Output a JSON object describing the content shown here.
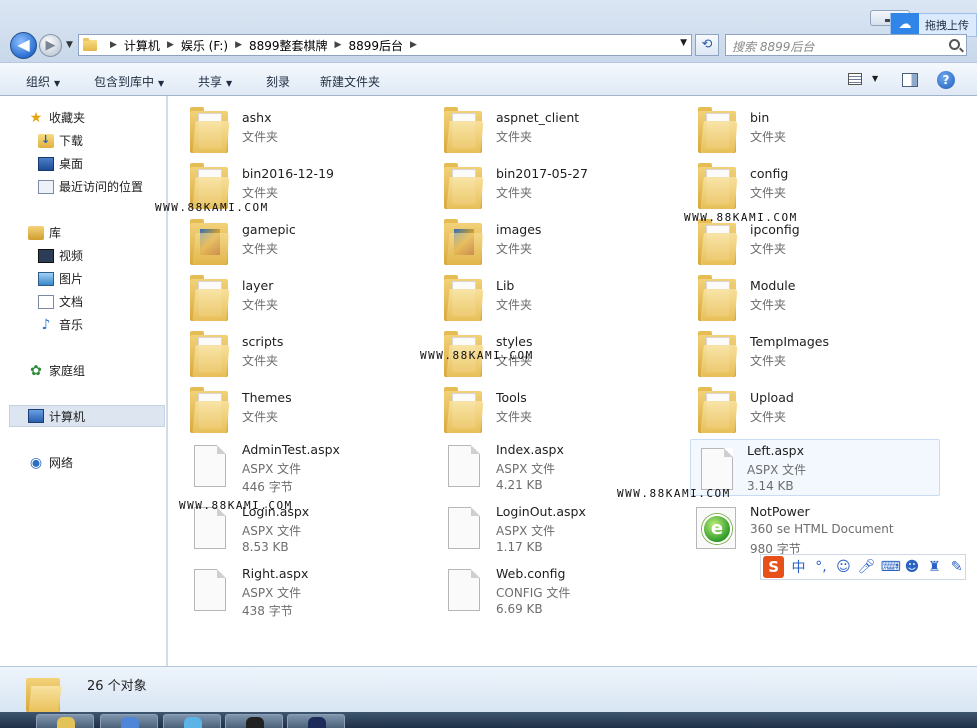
{
  "window": {
    "breadcrumb": [
      "计算机",
      "娱乐 (F:)",
      "8899整套棋牌",
      "8899后台"
    ],
    "search_placeholder": "搜索 8899后台",
    "cloud_label": "拖拽上传"
  },
  "toolbar": {
    "organize": "组织",
    "include_library": "包含到库中",
    "share": "共享",
    "burn": "刻录",
    "new_folder": "新建文件夹"
  },
  "sidebar": {
    "favorites": "收藏夹",
    "downloads": "下载",
    "desktop": "桌面",
    "recent": "最近访问的位置",
    "libraries": "库",
    "videos": "视频",
    "pictures": "图片",
    "documents": "文档",
    "music": "音乐",
    "homegroup": "家庭组",
    "computer": "计算机",
    "network": "网络"
  },
  "items": [
    {
      "name": "ashx",
      "type": "文件夹",
      "icon": "folder-icon"
    },
    {
      "name": "aspnet_client",
      "type": "文件夹",
      "icon": "folder-icon"
    },
    {
      "name": "bin",
      "type": "文件夹",
      "icon": "folder-icon"
    },
    {
      "name": "bin2016-12-19",
      "type": "文件夹",
      "icon": "folder-icon"
    },
    {
      "name": "bin2017-05-27",
      "type": "文件夹",
      "icon": "folder-icon"
    },
    {
      "name": "config",
      "type": "文件夹",
      "icon": "folder-icon"
    },
    {
      "name": "gamepic",
      "type": "文件夹",
      "icon": "picture-folder-icon"
    },
    {
      "name": "images",
      "type": "文件夹",
      "icon": "picture-folder-icon"
    },
    {
      "name": "ipconfig",
      "type": "文件夹",
      "icon": "folder-icon"
    },
    {
      "name": "layer",
      "type": "文件夹",
      "icon": "folder-icon"
    },
    {
      "name": "Lib",
      "type": "文件夹",
      "icon": "folder-icon"
    },
    {
      "name": "Module",
      "type": "文件夹",
      "icon": "folder-icon"
    },
    {
      "name": "scripts",
      "type": "文件夹",
      "icon": "folder-icon"
    },
    {
      "name": "styles",
      "type": "文件夹",
      "icon": "folder-icon"
    },
    {
      "name": "TempImages",
      "type": "文件夹",
      "icon": "folder-icon"
    },
    {
      "name": "Themes",
      "type": "文件夹",
      "icon": "folder-icon"
    },
    {
      "name": "Tools",
      "type": "文件夹",
      "icon": "folder-icon"
    },
    {
      "name": "Upload",
      "type": "文件夹",
      "icon": "folder-icon"
    },
    {
      "name": "AdminTest.aspx",
      "type": "ASPX 文件",
      "size": "446 字节",
      "icon": "file-icon"
    },
    {
      "name": "Index.aspx",
      "type": "ASPX 文件",
      "size": "4.21 KB",
      "icon": "file-icon"
    },
    {
      "name": "Left.aspx",
      "type": "ASPX 文件",
      "size": "3.14 KB",
      "icon": "file-icon"
    },
    {
      "name": "Login.aspx",
      "type": "ASPX 文件",
      "size": "8.53 KB",
      "icon": "file-icon"
    },
    {
      "name": "LoginOut.aspx",
      "type": "ASPX 文件",
      "size": "1.17 KB",
      "icon": "file-icon"
    },
    {
      "name": "NotPower",
      "type": "360 se HTML Document",
      "size": "980 字节",
      "icon": "html-document-icon"
    },
    {
      "name": "Right.aspx",
      "type": "ASPX 文件",
      "size": "438 字节",
      "icon": "file-icon"
    },
    {
      "name": "Web.config",
      "type": "CONFIG 文件",
      "size": "6.69 KB",
      "icon": "file-icon"
    }
  ],
  "watermark": "WWW.88KAMI.COM",
  "ime": {
    "label": "中"
  },
  "status": {
    "count": "26 个对象"
  }
}
